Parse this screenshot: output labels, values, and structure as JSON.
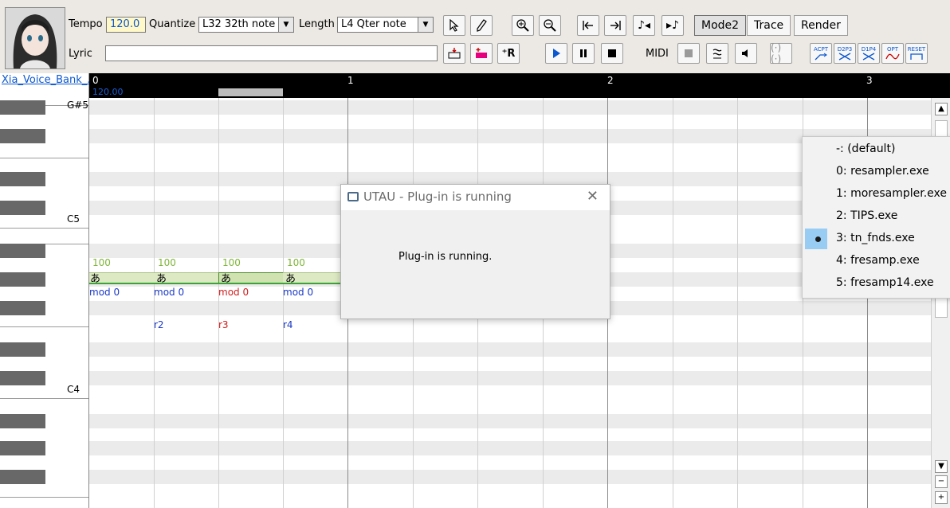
{
  "toolbar": {
    "tempo_label": "Tempo",
    "tempo_value": "120.0",
    "quantize_label": "Quantize",
    "quantize_value": "L32 32th note",
    "length_label": "Length",
    "length_value": "L4  Qter note",
    "mode2_label": "Mode2",
    "trace_label": "Trace",
    "render_label": "Render",
    "lyric_label": "Lyric",
    "lyric_value": "",
    "midi_label": "MIDI",
    "plugin_labels": [
      "ACPT",
      "D2P3",
      "D1P4",
      "OPT",
      "RESET"
    ]
  },
  "voicebank": {
    "name": "Xia_Voice_Bank_..."
  },
  "ruler": {
    "measures": [
      "0",
      "1",
      "2",
      "3"
    ],
    "tempo_mark": "120.00"
  },
  "piano": {
    "labels": [
      "G#5",
      "C5",
      "C4"
    ]
  },
  "notes": [
    {
      "velocity": "100",
      "lyric": "あ",
      "mod": "mod 0",
      "tag": "",
      "selected": false
    },
    {
      "velocity": "100",
      "lyric": "あ",
      "mod": "mod 0",
      "tag": "r2",
      "selected": false
    },
    {
      "velocity": "100",
      "lyric": "あ",
      "mod": "mod 0",
      "tag": "r3",
      "selected": true
    },
    {
      "velocity": "100",
      "lyric": "あ",
      "mod": "mod 0",
      "tag": "r4",
      "selected": false
    }
  ],
  "dialog": {
    "title": "UTAU - Plug-in is running",
    "message": "Plug-in is running."
  },
  "resampler_menu": {
    "items": [
      "-: (default)",
      "0: resampler.exe",
      "1: moresampler.exe",
      "2: TIPS.exe",
      "3: tn_fnds.exe",
      "4: fresamp.exe",
      "5: fresamp14.exe"
    ],
    "selected_index": 4
  },
  "scrollbar": {
    "up": "▲",
    "down": "▼",
    "minus": "−",
    "plus": "+"
  },
  "colors": {
    "accent_blue": "#0b57d0",
    "selected_red": "#d21c1c",
    "note_green": "#7fb43a",
    "menu_highlight": "#99ccf3"
  }
}
